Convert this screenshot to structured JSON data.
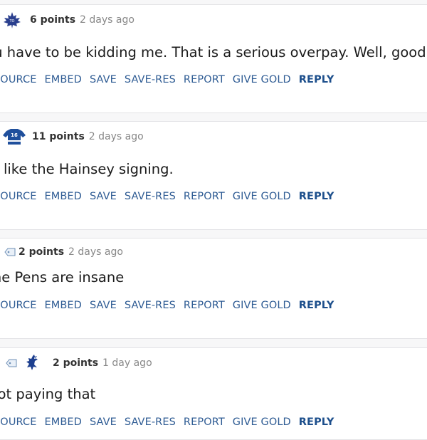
{
  "actions": {
    "source": "SOURCE",
    "embed": "EMBED",
    "save": "SAVE",
    "save_res": "SAVE-RES",
    "report": "REPORT",
    "give_gold": "GIVE GOLD",
    "reply": "REPLY"
  },
  "comments": [
    {
      "points": "6 points",
      "time": "2 days ago",
      "text": "You have to be kidding me. That is a serious overpay. Well, good for",
      "flair_icon": "maple-leaf-icon"
    },
    {
      "points": "11 points",
      "time": "2 days ago",
      "text": "I like the Hainsey signing.",
      "flair_icon": "jersey-16-icon"
    },
    {
      "points": "2 points",
      "time": "2 days ago",
      "text": "The Pens are insane",
      "flair_icon": "tag-icon"
    },
    {
      "points": "2 points",
      "time": "1 day ago",
      "text": "Not paying that",
      "flair_icon": "rooster-icon"
    }
  ],
  "colors": {
    "link": "#2f5c94",
    "reply": "#1d4f8c",
    "background": "#f7f7f8"
  }
}
